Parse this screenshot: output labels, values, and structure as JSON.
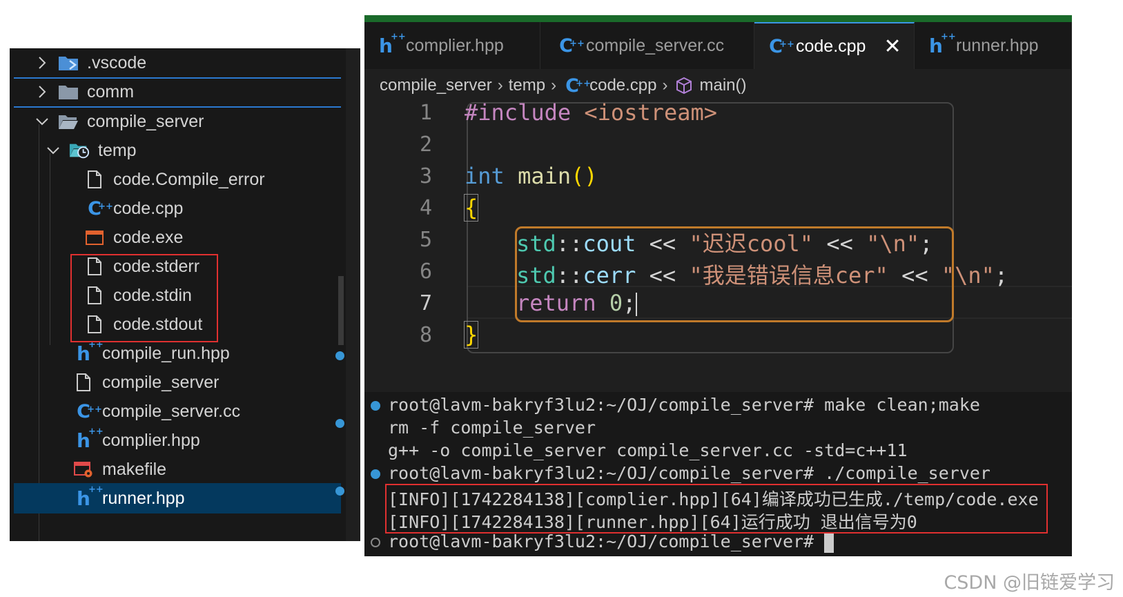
{
  "explorer": {
    "items": [
      {
        "label": ".vscode",
        "icon": "vscode-folder-icon",
        "expanded": false
      },
      {
        "label": "comm",
        "icon": "folder-icon",
        "expanded": false
      },
      {
        "label": "compile_server",
        "icon": "folder-open-icon",
        "expanded": true
      },
      {
        "label": "temp",
        "icon": "temp-folder-icon",
        "expanded": true
      },
      {
        "label": "code.Compile_error",
        "icon": "file-icon"
      },
      {
        "label": "code.cpp",
        "icon": "cpp-file-icon"
      },
      {
        "label": "code.exe",
        "icon": "exe-file-icon"
      },
      {
        "label": "code.stderr",
        "icon": "file-icon"
      },
      {
        "label": "code.stdin",
        "icon": "file-icon"
      },
      {
        "label": "code.stdout",
        "icon": "file-icon"
      },
      {
        "label": "compile_run.hpp",
        "icon": "hpp-file-icon"
      },
      {
        "label": "compile_server",
        "icon": "file-icon"
      },
      {
        "label": "compile_server.cc",
        "icon": "cpp-file-icon"
      },
      {
        "label": "complier.hpp",
        "icon": "hpp-file-icon"
      },
      {
        "label": "makefile",
        "icon": "makefile-icon"
      },
      {
        "label": "runner.hpp",
        "icon": "hpp-file-icon",
        "selected": true
      }
    ]
  },
  "editor": {
    "tabs": [
      {
        "label": "complier.hpp",
        "icon": "hpp-file-icon"
      },
      {
        "label": "compile_server.cc",
        "icon": "cpp-file-icon"
      },
      {
        "label": "code.cpp",
        "icon": "cpp-file-icon",
        "active": true
      },
      {
        "label": "runner.hpp",
        "icon": "hpp-file-icon"
      }
    ],
    "close_glyph": "✕",
    "breadcrumb": {
      "part1": "compile_server",
      "part2": "temp",
      "part3": "code.cpp",
      "part4": "main()",
      "sep": "›"
    },
    "line_numbers": [
      "1",
      "2",
      "3",
      "4",
      "5",
      "6",
      "7",
      "8"
    ],
    "active_line": "7",
    "code": {
      "l1_pre": "#include",
      "l1_hdr": " <iostream>",
      "l3_kw": "int",
      "l3_fn": " main",
      "l3_paren": "()",
      "l4_brace": "{",
      "l5_ns": "std",
      "l5_op1": "::",
      "l5_var": "cout",
      "l5_op2": " << ",
      "l5_str": "\"迟迟cool\"",
      "l5_op3": " << ",
      "l5_str2": "\"\\n\"",
      "l5_end": ";",
      "l6_ns": "std",
      "l6_op1": "::",
      "l6_var": "cerr",
      "l6_op2": " << ",
      "l6_str": "\"我是错误信息cer\"",
      "l6_op3": " << ",
      "l6_str2": "\"\\n\"",
      "l6_end": ";",
      "l7_kw": "return",
      "l7_num": " 0",
      "l7_end": ";",
      "l8_brace": "}"
    }
  },
  "terminal": {
    "lines": [
      "root@lavm-bakryf3lu2:~/OJ/compile_server# make clean;make",
      "rm -f compile_server",
      "g++ -o compile_server compile_server.cc -std=c++11",
      "root@lavm-bakryf3lu2:~/OJ/compile_server# ./compile_server",
      "[INFO][1742284138][complier.hpp][64]编译成功已生成./temp/code.exe",
      "[INFO][1742284138][runner.hpp][64]运行成功 退出信号为0",
      "root@lavm-bakryf3lu2:~/OJ/compile_server# "
    ]
  },
  "watermark": "CSDN @旧链爱学习",
  "colors": {
    "accent": "#3b95e6",
    "highlight_box": "#e03030",
    "code_outline": "#c07a2a",
    "selection": "#04395e"
  }
}
